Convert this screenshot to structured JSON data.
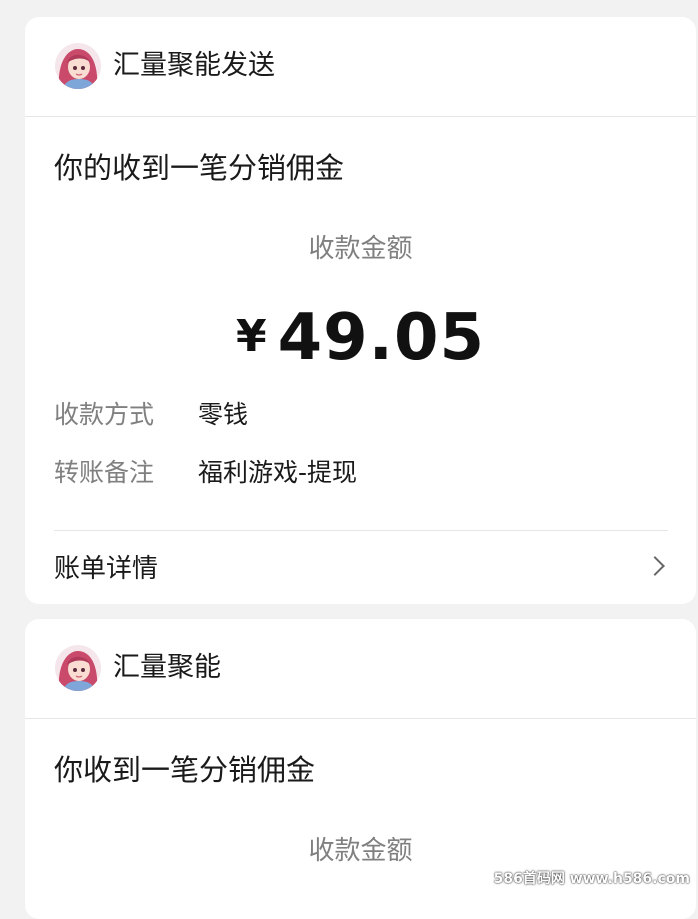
{
  "messages": [
    {
      "sender": "汇量聚能发送",
      "title": "你的收到一笔分销佣金",
      "amount_label": "收款金额",
      "currency": "¥",
      "amount": "49.05",
      "details": [
        {
          "label": "收款方式",
          "value": "零钱"
        },
        {
          "label": "转账备注",
          "value": "福利游戏-提现"
        }
      ],
      "bill_link": "账单详情"
    },
    {
      "sender": "汇量聚能",
      "title": "你收到一笔分销佣金",
      "amount_label": "收款金额"
    }
  ],
  "watermark": "586首码网 www.h586.com",
  "icons": {
    "avatar": "anime-avatar-icon",
    "arrow": "chevron-right-icon"
  },
  "colors": {
    "background": "#f2f2f2",
    "card": "#ffffff",
    "secondary_text": "#808080",
    "avatar_hair": "#c94a6a"
  }
}
